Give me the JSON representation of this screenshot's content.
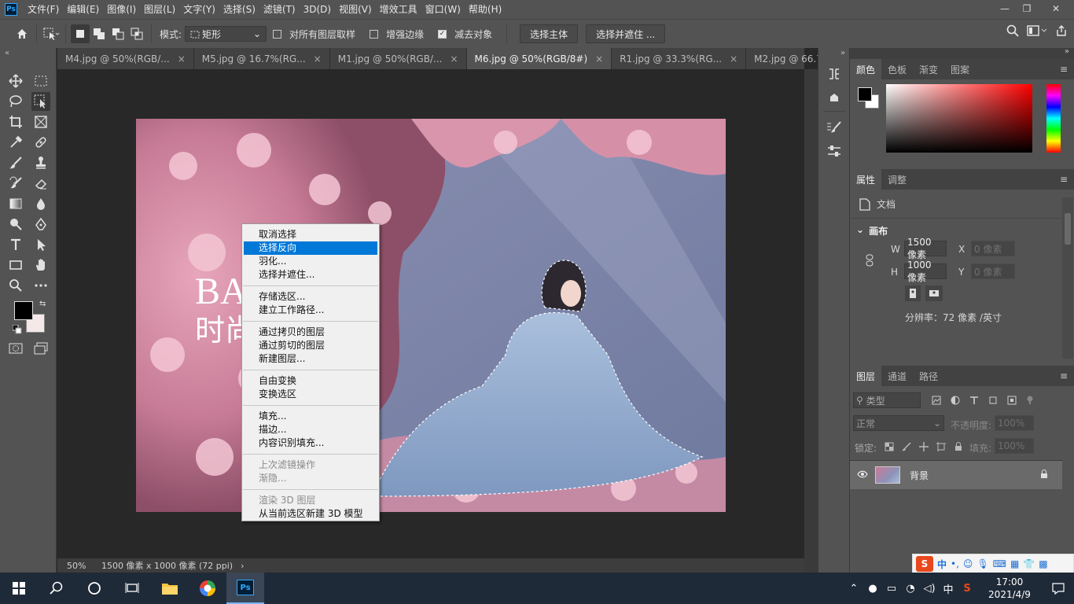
{
  "menubar": {
    "logo": "Ps",
    "items": [
      "文件(F)",
      "编辑(E)",
      "图像(I)",
      "图层(L)",
      "文字(Y)",
      "选择(S)",
      "滤镜(T)",
      "3D(D)",
      "视图(V)",
      "增效工具",
      "窗口(W)",
      "帮助(H)"
    ],
    "window_controls": [
      "—",
      "❐",
      "✕"
    ]
  },
  "options": {
    "mode_label": "模式:",
    "mode_value": "矩形",
    "sample_all_label": "对所有图层取样",
    "sample_all_checked": false,
    "enhance_edge_label": "增强边缘",
    "enhance_edge_checked": false,
    "subtract_label": "减去对象",
    "subtract_checked": true,
    "select_subject": "选择主体",
    "select_mask": "选择并遮住 ..."
  },
  "tabs": [
    {
      "label": "M4.jpg @ 50%(RGB/...",
      "active": false
    },
    {
      "label": "M5.jpg @ 16.7%(RG...",
      "active": false
    },
    {
      "label": "M1.jpg @ 50%(RGB/...",
      "active": false
    },
    {
      "label": "M6.jpg @ 50%(RGB/8#)",
      "active": true
    },
    {
      "label": "R1.jpg @ 33.3%(RG...",
      "active": false
    },
    {
      "label": "M2.jpg @ 66.7%(RG...",
      "active": false
    }
  ],
  "tab_close": "×",
  "canvas_text": {
    "line1": "BA",
    "line2": "时尚"
  },
  "context_menu": {
    "groups": [
      [
        {
          "label": "取消选择"
        },
        {
          "label": "选择反向",
          "highlighted": true
        },
        {
          "label": "羽化..."
        },
        {
          "label": "选择并遮住..."
        }
      ],
      [
        {
          "label": "存储选区..."
        },
        {
          "label": "建立工作路径..."
        }
      ],
      [
        {
          "label": "通过拷贝的图层"
        },
        {
          "label": "通过剪切的图层"
        },
        {
          "label": "新建图层..."
        }
      ],
      [
        {
          "label": "自由变换"
        },
        {
          "label": "变换选区"
        }
      ],
      [
        {
          "label": "填充..."
        },
        {
          "label": "描边..."
        },
        {
          "label": "内容识别填充..."
        }
      ],
      [
        {
          "label": "上次滤镜操作",
          "disabled": true
        },
        {
          "label": "渐隐...",
          "disabled": true
        }
      ],
      [
        {
          "label": "渲染 3D 图层",
          "disabled": true
        },
        {
          "label": "从当前选区新建 3D 模型"
        }
      ]
    ]
  },
  "status": {
    "zoom": "50%",
    "doc_size": "1500 像素 x 1000 像素 (72 ppi)",
    "arrow": "›"
  },
  "color_panel": {
    "tabs": [
      "颜色",
      "色板",
      "渐变",
      "图案"
    ]
  },
  "properties_panel": {
    "tabs": [
      "属性",
      "调整"
    ],
    "doc_label": "文档",
    "canvas_label": "画布",
    "w_label": "W",
    "w_value": "1500 像素",
    "h_label": "H",
    "h_value": "1000 像素",
    "x_label": "X",
    "x_placeholder": "0 像素",
    "y_label": "Y",
    "y_placeholder": "0 像素",
    "resolution": "分辨率：72 像素 /英寸"
  },
  "layers_panel": {
    "tabs": [
      "图层",
      "通道",
      "路径"
    ],
    "filter_label": "类型",
    "blend_mode": "正常",
    "opacity_label": "不透明度:",
    "opacity_value": "100%",
    "lock_label": "锁定:",
    "fill_label": "填充:",
    "fill_value": "100%",
    "layers": [
      {
        "name": "背景",
        "visible": true,
        "locked": true
      }
    ]
  },
  "ime": {
    "label": "中",
    "punct": "•,"
  },
  "taskbar": {
    "time": "17:00",
    "date": "2021/4/9",
    "lang": "中",
    "app_label": "Ps"
  },
  "colors": {
    "accent": "#0078d7",
    "ps_blue": "#31a8ff",
    "panel_bg": "#535353",
    "canvas_bg": "#282828"
  }
}
